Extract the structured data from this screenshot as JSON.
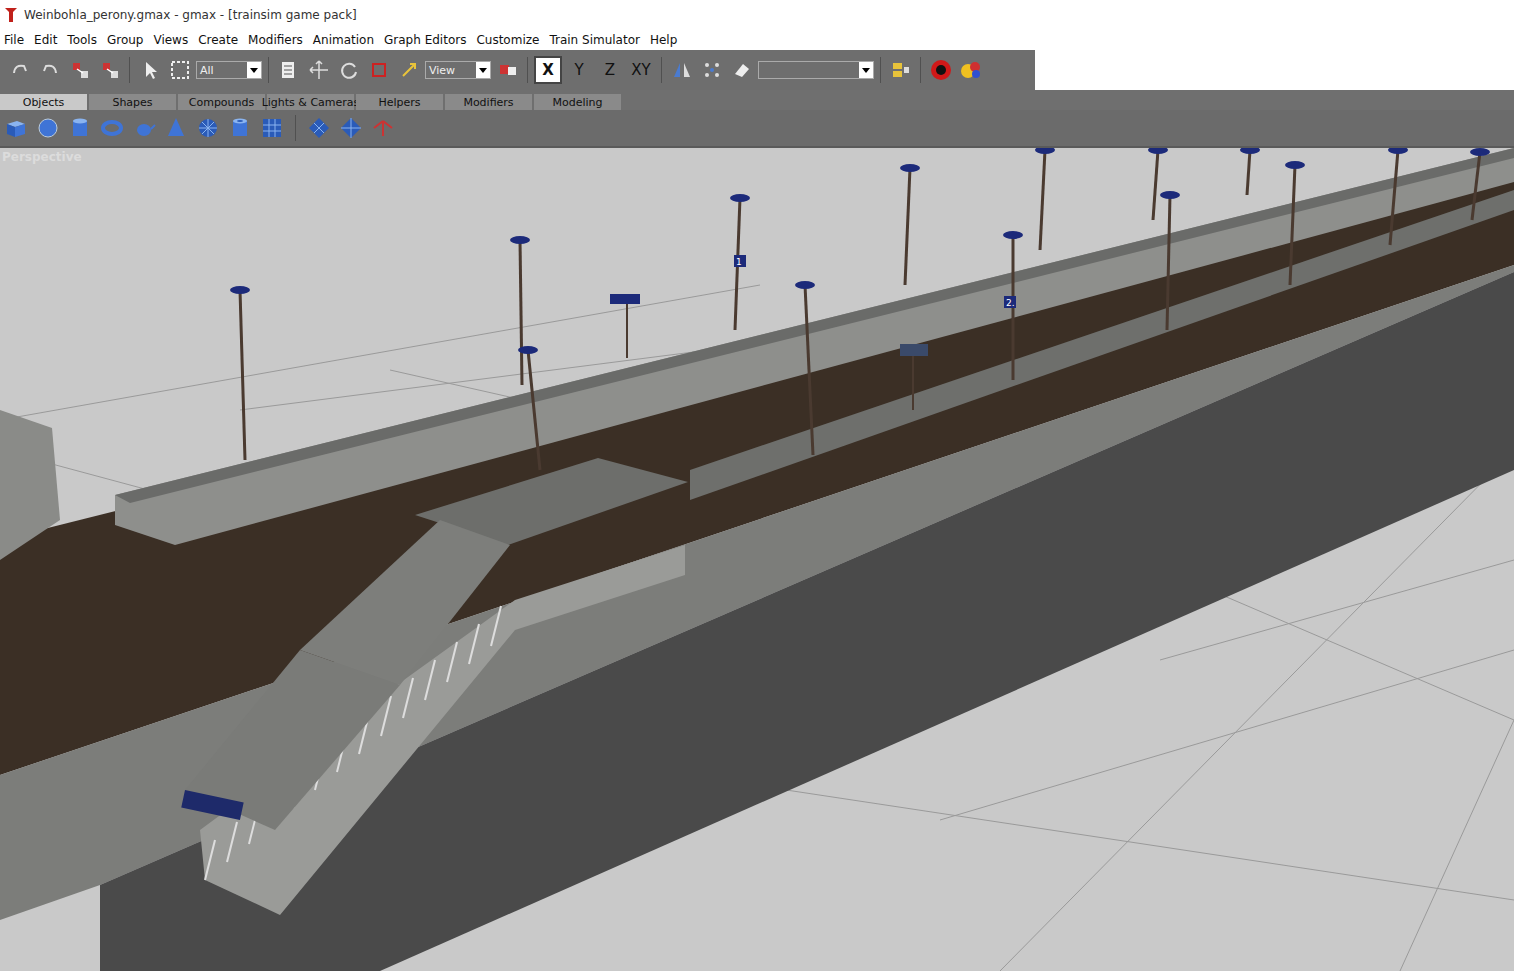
{
  "window": {
    "title": "Weinbohla_perony.gmax - gmax - [trainsim game pack]"
  },
  "menu": [
    "File",
    "Edit",
    "Tools",
    "Group",
    "Views",
    "Create",
    "Modifiers",
    "Animation",
    "Graph Editors",
    "Customize",
    "Train Simulator",
    "Help"
  ],
  "toolbar": {
    "selection_filter": "All",
    "reference_coordinate": "View",
    "axes": [
      {
        "label": "X",
        "selected": true
      },
      {
        "label": "Y",
        "selected": false
      },
      {
        "label": "Z",
        "selected": false
      },
      {
        "label": "XY",
        "selected": false
      }
    ]
  },
  "tabs": [
    {
      "label": "Objects",
      "selected": true
    },
    {
      "label": "Shapes",
      "selected": false
    },
    {
      "label": "Compounds",
      "selected": false
    },
    {
      "label": "Lights & Cameras",
      "selected": false
    },
    {
      "label": "Helpers",
      "selected": false
    },
    {
      "label": "Modifiers",
      "selected": false
    },
    {
      "label": "Modeling",
      "selected": false
    }
  ],
  "viewport": {
    "label": "Perspective",
    "signs": [
      "1",
      "2."
    ]
  }
}
